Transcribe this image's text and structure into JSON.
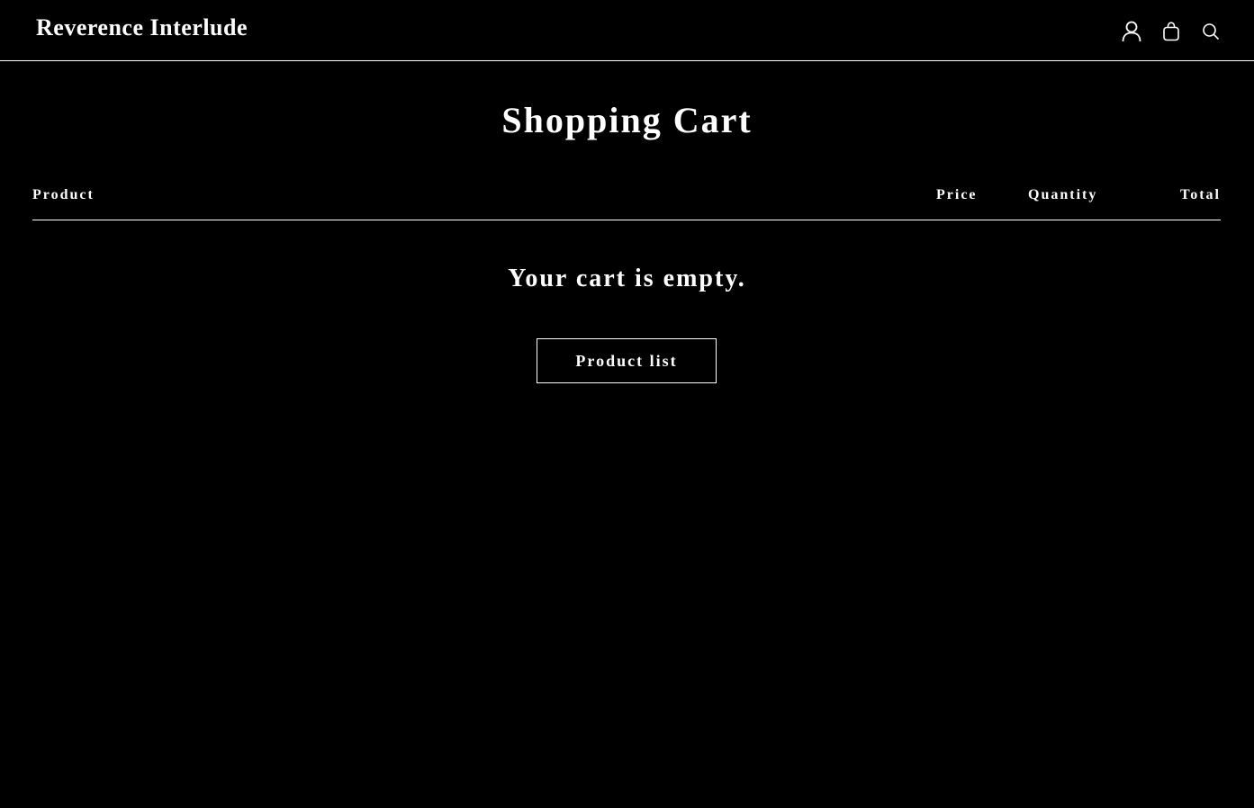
{
  "header": {
    "logo": "Reverence Interlude",
    "icons": [
      "account-icon",
      "cart-icon",
      "search-icon"
    ]
  },
  "page": {
    "title": "Shopping Cart"
  },
  "cart_table": {
    "columns": {
      "product": "Product",
      "price": "Price",
      "quantity": "Quantity",
      "total": "Total"
    }
  },
  "empty_state": {
    "message": "Your cart is empty.",
    "button_label": "Product list"
  },
  "colors": {
    "background": "#000000",
    "text": "#ffffff",
    "border": "#ffffff"
  }
}
